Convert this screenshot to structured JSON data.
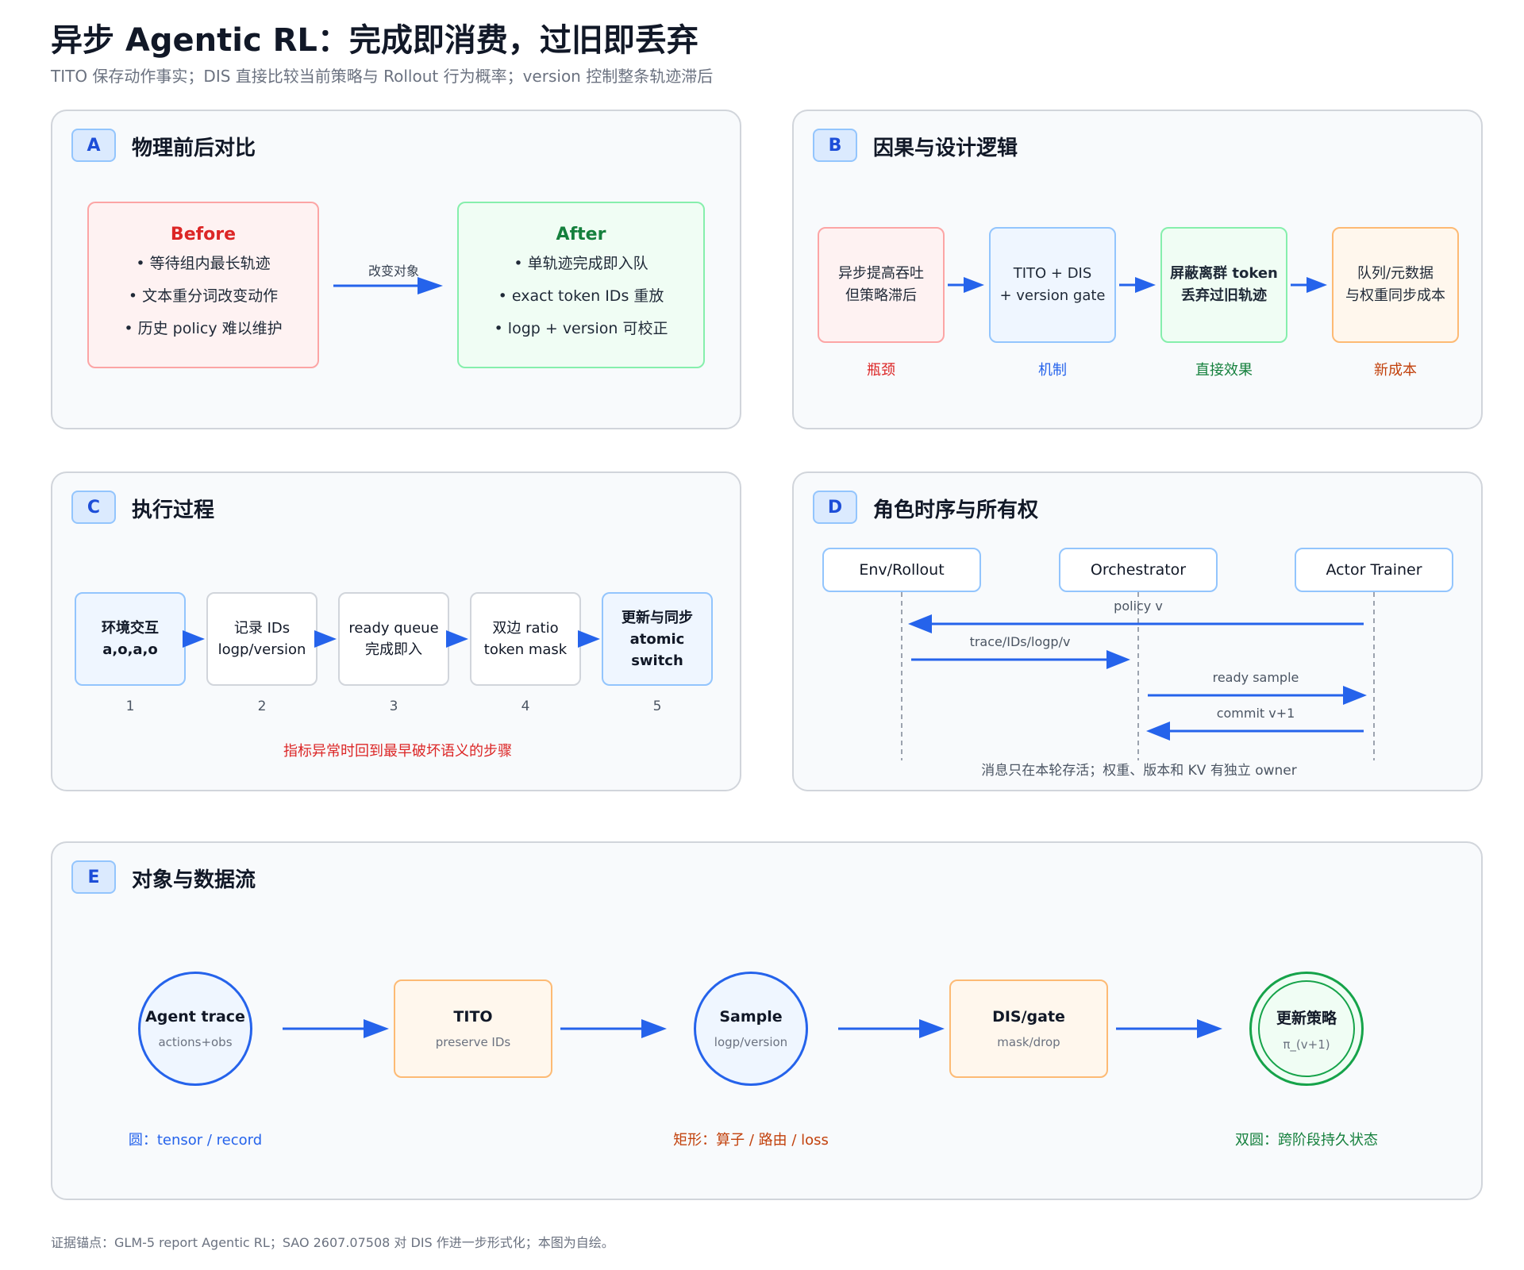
{
  "header": {
    "title": "异步 Agentic RL：完成即消费，过旧即丢弃",
    "subtitle": "TITO 保存动作事实；DIS 直接比较当前策略与 Rollout 行为概率；version 控制整条轨迹滞后"
  },
  "panel_a": {
    "badge": "A",
    "title": "物理前后对比",
    "before": {
      "heading": "Before",
      "items": [
        "• 等待组内最长轨迹",
        "• 文本重分词改变动作",
        "• 历史 policy 难以维护"
      ]
    },
    "arrow_label": "改变对象",
    "after": {
      "heading": "After",
      "items": [
        "• 单轨迹完成即入队",
        "• exact token IDs 重放",
        "• logp + version 可校正"
      ]
    }
  },
  "panel_b": {
    "badge": "B",
    "title": "因果与设计逻辑",
    "steps": [
      {
        "line1": "异步提高吞吐",
        "line2": "但策略滞后",
        "label": "瓶颈"
      },
      {
        "line1": "TITO + DIS",
        "line2": "+ version gate",
        "label": "机制"
      },
      {
        "line1": "屏蔽离群 token",
        "line2": "丢弃过旧轨迹",
        "label": "直接效果"
      },
      {
        "line1": "队列/元数据",
        "line2": "与权重同步成本",
        "label": "新成本"
      }
    ]
  },
  "panel_c": {
    "badge": "C",
    "title": "执行过程",
    "steps": [
      {
        "line1": "环境交互",
        "line2": "a,o,a,o",
        "num": "1"
      },
      {
        "line1": "记录 IDs",
        "line2": "logp/version",
        "num": "2"
      },
      {
        "line1": "ready queue",
        "line2": "完成即入",
        "num": "3"
      },
      {
        "line1": "双边 ratio",
        "line2": "token mask",
        "num": "4"
      },
      {
        "line1": "更新与同步",
        "line2": "atomic switch",
        "num": "5"
      }
    ],
    "note": "指标异常时回到最早破坏语义的步骤"
  },
  "panel_d": {
    "badge": "D",
    "title": "角色时序与所有权",
    "actors": [
      "Env/Rollout",
      "Orchestrator",
      "Actor Trainer"
    ],
    "messages": [
      "policy v",
      "trace/IDs/logp/v",
      "ready sample",
      "commit v+1"
    ],
    "note": "消息只在本轮存活；权重、版本和 KV 有独立 owner"
  },
  "panel_e": {
    "badge": "E",
    "title": "对象与数据流",
    "nodes": [
      {
        "title": "Agent trace",
        "sub": "actions+obs"
      },
      {
        "title": "TITO",
        "sub": "preserve IDs"
      },
      {
        "title": "Sample",
        "sub": "logp/version"
      },
      {
        "title": "DIS/gate",
        "sub": "mask/drop"
      },
      {
        "title": "更新策略",
        "sub": "π_(v+1)"
      }
    ],
    "legend": [
      "圆：tensor / record",
      "矩形：算子 / 路由 / loss",
      "双圆：跨阶段持久状态"
    ]
  },
  "footer": "证据锚点：GLM-5 report Agentic RL；SAO 2607.07508 对 DIS 作进一步形式化；本图为自绘。",
  "colors": {
    "arrow": "#2563eb",
    "red": "#dc2626",
    "green": "#15803d",
    "blue": "#2563eb",
    "orange": "#c2410c"
  }
}
